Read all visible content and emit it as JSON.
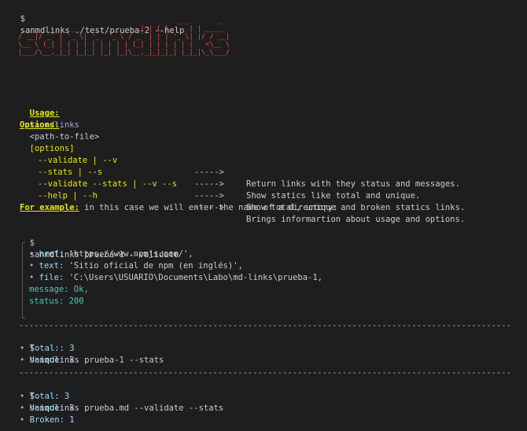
{
  "prompt": "$",
  "command": "sanmdlinks ./test/prueba-2 --help",
  "banner_art": [
    "                                        _ _       _        ",
    "  ___  __ _ _ __  _ __ ___   __| | (_)_ __ | | _____ ",
    " / __|/ _` | '_ \\| '_ ` _ \\ / _` | | | '_ \\| |/ / __|",
    " \\__ \\ (_| | | | | | | | | | (_| | | | | | |   <\\__ \\",
    " |___/\\__,_|_| |_|_| |_| |_|\\__,_|_|_|_| |_|_|\\_\\___/"
  ],
  "usage": {
    "label": "Usage:",
    "cmd": "sanmdlinks",
    "arg": "<path-to-file>",
    "options": "[options]"
  },
  "options_title": "Options:",
  "options": [
    {
      "flag": "--validate | --v",
      "arrow": "----->",
      "desc": "Return links with they status and messages."
    },
    {
      "flag": "--stats | --s",
      "arrow": "----->",
      "desc": "Show statics like total and unique."
    },
    {
      "flag": "--validate --stats | --v --s",
      "arrow": "----->",
      "desc": "Show total, unique and broken statics links."
    },
    {
      "flag": "--help | --h",
      "arrow": "----->",
      "desc": "Brings informartion about usage and options."
    }
  ],
  "example": {
    "label": "For example:",
    "text": " in this case we will enter the name of a directory:"
  },
  "example1": {
    "command": "sanmdlinks prueba-1 --validate",
    "href_key": "href:",
    "href_val": "'https://www.npmjs.com/',",
    "text_key": "text:",
    "text_val": "'Sitio oficial de npm (en inglés)',",
    "file_key": "file:",
    "file_val": "'C:\\Users\\USUARIO\\Documents\\Labo\\md-links\\prueba-1,",
    "message": "message: Ok,",
    "status": "status: 200"
  },
  "separator": "----------------------------------------------------------------------------------------------------------",
  "example2": {
    "command": "sanmdlinks prueba-1 --stats",
    "total": "Total:: 3",
    "unique": "Unique: 3"
  },
  "example3": {
    "command": "sanmdlinks prueba.md --validate --stats",
    "total": "Total: 3",
    "unique": "Unique: 3",
    "broken": "Broken: 1"
  },
  "bullet": "•",
  "colors": {
    "background": "#1e1e1e",
    "banner": "#f14c4c",
    "yellow": "#e5e510",
    "purple": "#b39ddb"
  }
}
